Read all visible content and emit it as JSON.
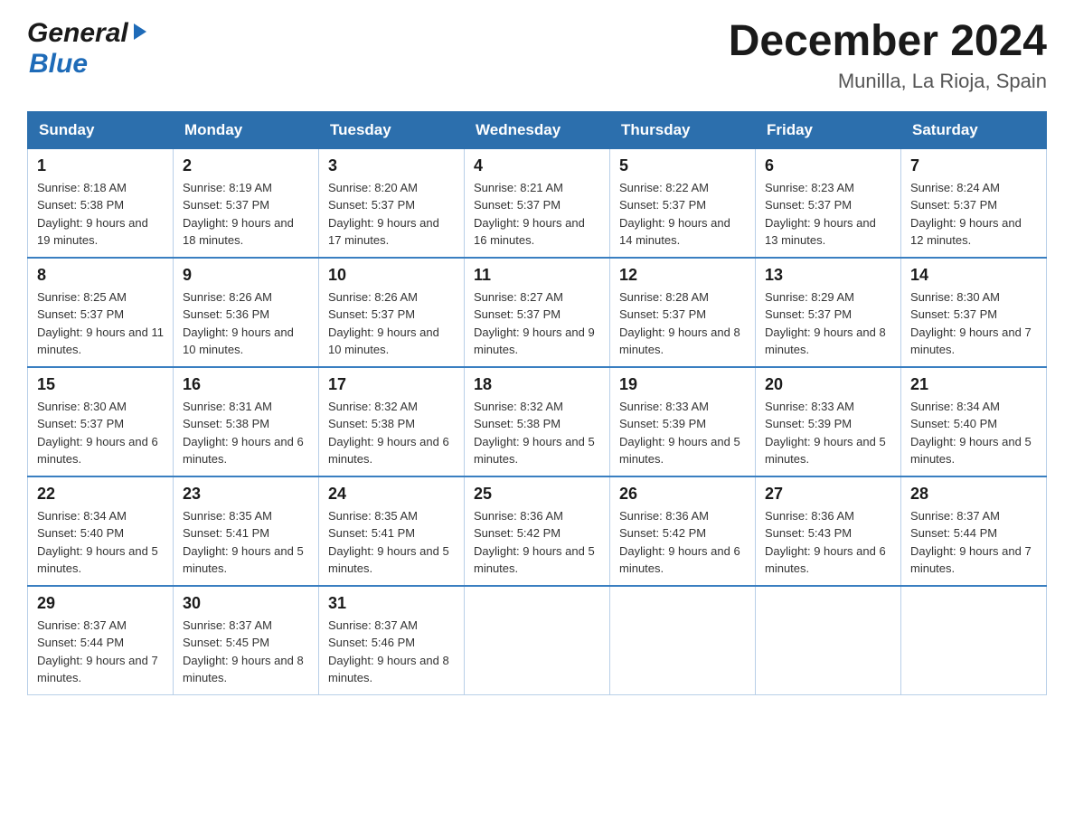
{
  "header": {
    "logo_general": "General",
    "logo_blue": "Blue",
    "month_title": "December 2024",
    "location": "Munilla, La Rioja, Spain"
  },
  "days_of_week": [
    "Sunday",
    "Monday",
    "Tuesday",
    "Wednesday",
    "Thursday",
    "Friday",
    "Saturday"
  ],
  "weeks": [
    {
      "days": [
        {
          "num": "1",
          "sunrise": "Sunrise: 8:18 AM",
          "sunset": "Sunset: 5:38 PM",
          "daylight": "Daylight: 9 hours and 19 minutes."
        },
        {
          "num": "2",
          "sunrise": "Sunrise: 8:19 AM",
          "sunset": "Sunset: 5:37 PM",
          "daylight": "Daylight: 9 hours and 18 minutes."
        },
        {
          "num": "3",
          "sunrise": "Sunrise: 8:20 AM",
          "sunset": "Sunset: 5:37 PM",
          "daylight": "Daylight: 9 hours and 17 minutes."
        },
        {
          "num": "4",
          "sunrise": "Sunrise: 8:21 AM",
          "sunset": "Sunset: 5:37 PM",
          "daylight": "Daylight: 9 hours and 16 minutes."
        },
        {
          "num": "5",
          "sunrise": "Sunrise: 8:22 AM",
          "sunset": "Sunset: 5:37 PM",
          "daylight": "Daylight: 9 hours and 14 minutes."
        },
        {
          "num": "6",
          "sunrise": "Sunrise: 8:23 AM",
          "sunset": "Sunset: 5:37 PM",
          "daylight": "Daylight: 9 hours and 13 minutes."
        },
        {
          "num": "7",
          "sunrise": "Sunrise: 8:24 AM",
          "sunset": "Sunset: 5:37 PM",
          "daylight": "Daylight: 9 hours and 12 minutes."
        }
      ]
    },
    {
      "days": [
        {
          "num": "8",
          "sunrise": "Sunrise: 8:25 AM",
          "sunset": "Sunset: 5:37 PM",
          "daylight": "Daylight: 9 hours and 11 minutes."
        },
        {
          "num": "9",
          "sunrise": "Sunrise: 8:26 AM",
          "sunset": "Sunset: 5:36 PM",
          "daylight": "Daylight: 9 hours and 10 minutes."
        },
        {
          "num": "10",
          "sunrise": "Sunrise: 8:26 AM",
          "sunset": "Sunset: 5:37 PM",
          "daylight": "Daylight: 9 hours and 10 minutes."
        },
        {
          "num": "11",
          "sunrise": "Sunrise: 8:27 AM",
          "sunset": "Sunset: 5:37 PM",
          "daylight": "Daylight: 9 hours and 9 minutes."
        },
        {
          "num": "12",
          "sunrise": "Sunrise: 8:28 AM",
          "sunset": "Sunset: 5:37 PM",
          "daylight": "Daylight: 9 hours and 8 minutes."
        },
        {
          "num": "13",
          "sunrise": "Sunrise: 8:29 AM",
          "sunset": "Sunset: 5:37 PM",
          "daylight": "Daylight: 9 hours and 8 minutes."
        },
        {
          "num": "14",
          "sunrise": "Sunrise: 8:30 AM",
          "sunset": "Sunset: 5:37 PM",
          "daylight": "Daylight: 9 hours and 7 minutes."
        }
      ]
    },
    {
      "days": [
        {
          "num": "15",
          "sunrise": "Sunrise: 8:30 AM",
          "sunset": "Sunset: 5:37 PM",
          "daylight": "Daylight: 9 hours and 6 minutes."
        },
        {
          "num": "16",
          "sunrise": "Sunrise: 8:31 AM",
          "sunset": "Sunset: 5:38 PM",
          "daylight": "Daylight: 9 hours and 6 minutes."
        },
        {
          "num": "17",
          "sunrise": "Sunrise: 8:32 AM",
          "sunset": "Sunset: 5:38 PM",
          "daylight": "Daylight: 9 hours and 6 minutes."
        },
        {
          "num": "18",
          "sunrise": "Sunrise: 8:32 AM",
          "sunset": "Sunset: 5:38 PM",
          "daylight": "Daylight: 9 hours and 5 minutes."
        },
        {
          "num": "19",
          "sunrise": "Sunrise: 8:33 AM",
          "sunset": "Sunset: 5:39 PM",
          "daylight": "Daylight: 9 hours and 5 minutes."
        },
        {
          "num": "20",
          "sunrise": "Sunrise: 8:33 AM",
          "sunset": "Sunset: 5:39 PM",
          "daylight": "Daylight: 9 hours and 5 minutes."
        },
        {
          "num": "21",
          "sunrise": "Sunrise: 8:34 AM",
          "sunset": "Sunset: 5:40 PM",
          "daylight": "Daylight: 9 hours and 5 minutes."
        }
      ]
    },
    {
      "days": [
        {
          "num": "22",
          "sunrise": "Sunrise: 8:34 AM",
          "sunset": "Sunset: 5:40 PM",
          "daylight": "Daylight: 9 hours and 5 minutes."
        },
        {
          "num": "23",
          "sunrise": "Sunrise: 8:35 AM",
          "sunset": "Sunset: 5:41 PM",
          "daylight": "Daylight: 9 hours and 5 minutes."
        },
        {
          "num": "24",
          "sunrise": "Sunrise: 8:35 AM",
          "sunset": "Sunset: 5:41 PM",
          "daylight": "Daylight: 9 hours and 5 minutes."
        },
        {
          "num": "25",
          "sunrise": "Sunrise: 8:36 AM",
          "sunset": "Sunset: 5:42 PM",
          "daylight": "Daylight: 9 hours and 5 minutes."
        },
        {
          "num": "26",
          "sunrise": "Sunrise: 8:36 AM",
          "sunset": "Sunset: 5:42 PM",
          "daylight": "Daylight: 9 hours and 6 minutes."
        },
        {
          "num": "27",
          "sunrise": "Sunrise: 8:36 AM",
          "sunset": "Sunset: 5:43 PM",
          "daylight": "Daylight: 9 hours and 6 minutes."
        },
        {
          "num": "28",
          "sunrise": "Sunrise: 8:37 AM",
          "sunset": "Sunset: 5:44 PM",
          "daylight": "Daylight: 9 hours and 7 minutes."
        }
      ]
    },
    {
      "days": [
        {
          "num": "29",
          "sunrise": "Sunrise: 8:37 AM",
          "sunset": "Sunset: 5:44 PM",
          "daylight": "Daylight: 9 hours and 7 minutes."
        },
        {
          "num": "30",
          "sunrise": "Sunrise: 8:37 AM",
          "sunset": "Sunset: 5:45 PM",
          "daylight": "Daylight: 9 hours and 8 minutes."
        },
        {
          "num": "31",
          "sunrise": "Sunrise: 8:37 AM",
          "sunset": "Sunset: 5:46 PM",
          "daylight": "Daylight: 9 hours and 8 minutes."
        },
        null,
        null,
        null,
        null
      ]
    }
  ]
}
